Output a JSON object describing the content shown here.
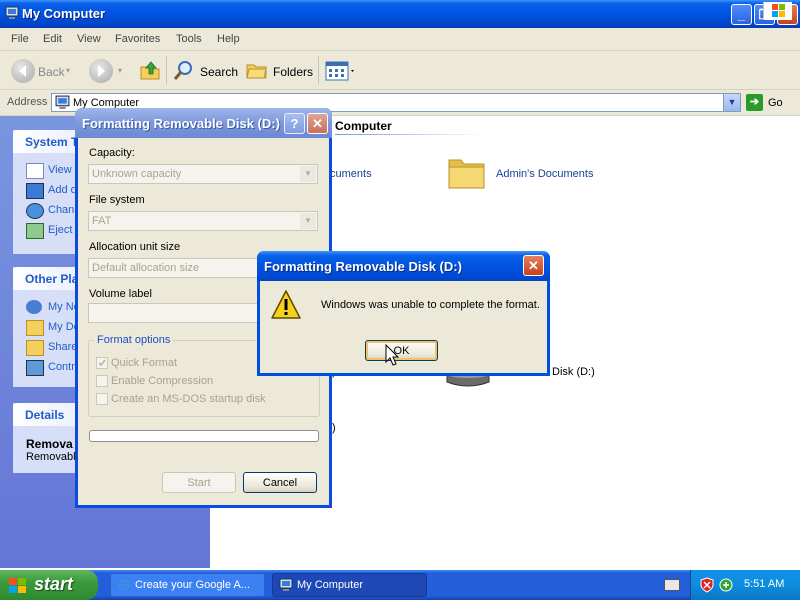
{
  "window": {
    "title": "My Computer",
    "buttons": {
      "minimize": "_",
      "maximize": "❐",
      "close": "✕"
    }
  },
  "menu": [
    "File",
    "Edit",
    "View",
    "Favorites",
    "Tools",
    "Help"
  ],
  "toolbar": {
    "back": "Back",
    "search": "Search",
    "folders": "Folders"
  },
  "address": {
    "label": "Address",
    "value": "My Computer",
    "go": "Go"
  },
  "taskpane": {
    "system_tasks": {
      "title": "System T",
      "items": [
        "View s",
        "Add o",
        "Chan",
        "Eject"
      ]
    },
    "other_places": {
      "title": "Other Pla",
      "items": [
        "My Ne",
        "My Do",
        "Share",
        "Contr"
      ]
    },
    "details": {
      "title": "Details",
      "name": "Remova",
      "type": "Removable"
    }
  },
  "content": {
    "section_header": "Computer",
    "items": [
      "cuments",
      "Admin's Documents"
    ],
    "drive_label": "Disk (D:)",
    "fragment": ")"
  },
  "format_dialog": {
    "title": "Formatting Removable Disk (D:)",
    "capacity_label": "Capacity:",
    "capacity_value": "Unknown capacity",
    "filesystem_label": "File system",
    "filesystem_value": "FAT",
    "allocation_label": "Allocation unit size",
    "allocation_value": "Default allocation size",
    "volume_label": "Volume label",
    "options_legend": "Format options",
    "options": [
      "Quick Format",
      "Enable Compression",
      "Create an MS-DOS startup disk"
    ],
    "start_label": "Start",
    "cancel_label": "Cancel"
  },
  "error_dialog": {
    "title": "Formatting Removable Disk (D:)",
    "message": "Windows was unable to complete the format.",
    "ok_label": "OK"
  },
  "taskbar": {
    "start_label": "start",
    "tasks": [
      "Create your Google A...",
      "My Computer"
    ],
    "clock": "5:51 AM"
  },
  "colors": {
    "xp_blue": "#0054e3",
    "taskpane_blue": "#6375d6",
    "dialog_face": "#ece9d8",
    "start_green": "#3c9a3c"
  }
}
